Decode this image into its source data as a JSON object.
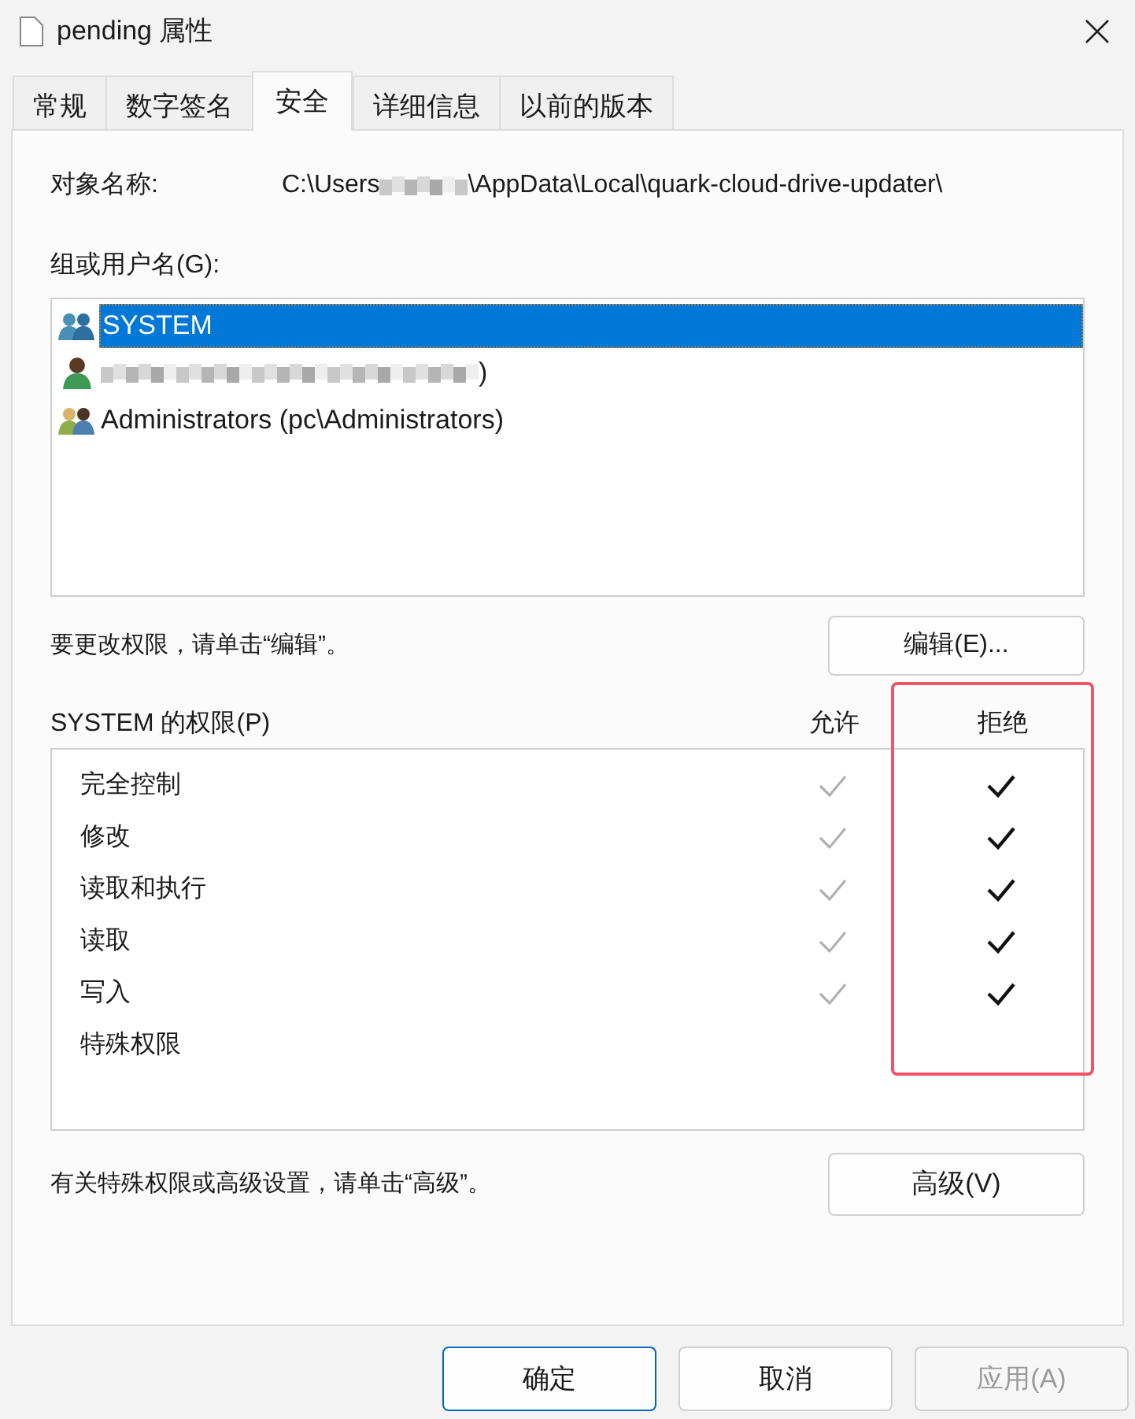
{
  "window": {
    "title": "pending 属性"
  },
  "tabs": [
    {
      "label": "常规",
      "selected": false
    },
    {
      "label": "数字签名",
      "selected": false
    },
    {
      "label": "安全",
      "selected": true
    },
    {
      "label": "详细信息",
      "selected": false
    },
    {
      "label": "以前的版本",
      "selected": false
    }
  ],
  "object_name": {
    "label": "对象名称:",
    "path_start": "C:\\Users",
    "path_end": "\\AppData\\Local\\quark-cloud-drive-updater\\",
    "redacted": true
  },
  "users": {
    "label": "组或用户名(G):",
    "items": [
      {
        "kind": "group",
        "name": "SYSTEM",
        "redacted": false,
        "selected": true
      },
      {
        "kind": "user",
        "name": ")",
        "redacted": true,
        "selected": false
      },
      {
        "kind": "admins",
        "name": "Administrators (pc\\Administrators)",
        "redacted": false,
        "selected": false
      }
    ]
  },
  "edit_hint": "要更改权限，请单击“编辑”。",
  "edit_button": "编辑(E)...",
  "permissions": {
    "title": "SYSTEM 的权限(P)",
    "allow_header": "允许",
    "deny_header": "拒绝",
    "deny_highlighted": true,
    "rows": [
      {
        "name": "完全控制",
        "allow_checked": true,
        "allow_inherited": true,
        "deny_checked": true
      },
      {
        "name": "修改",
        "allow_checked": true,
        "allow_inherited": true,
        "deny_checked": true
      },
      {
        "name": "读取和执行",
        "allow_checked": true,
        "allow_inherited": true,
        "deny_checked": true
      },
      {
        "name": "读取",
        "allow_checked": true,
        "allow_inherited": true,
        "deny_checked": true
      },
      {
        "name": "写入",
        "allow_checked": true,
        "allow_inherited": true,
        "deny_checked": true
      },
      {
        "name": "特殊权限",
        "allow_checked": false,
        "deny_checked": false
      }
    ]
  },
  "advanced_hint": "有关特殊权限或高级设置，请单击“高级”。",
  "advanced_button": "高级(V)",
  "footer": [
    {
      "label": "确定",
      "kind": "default",
      "disabled": false
    },
    {
      "label": "取消",
      "kind": "normal",
      "disabled": false
    },
    {
      "label": "应用(A)",
      "kind": "normal",
      "disabled": true
    }
  ]
}
